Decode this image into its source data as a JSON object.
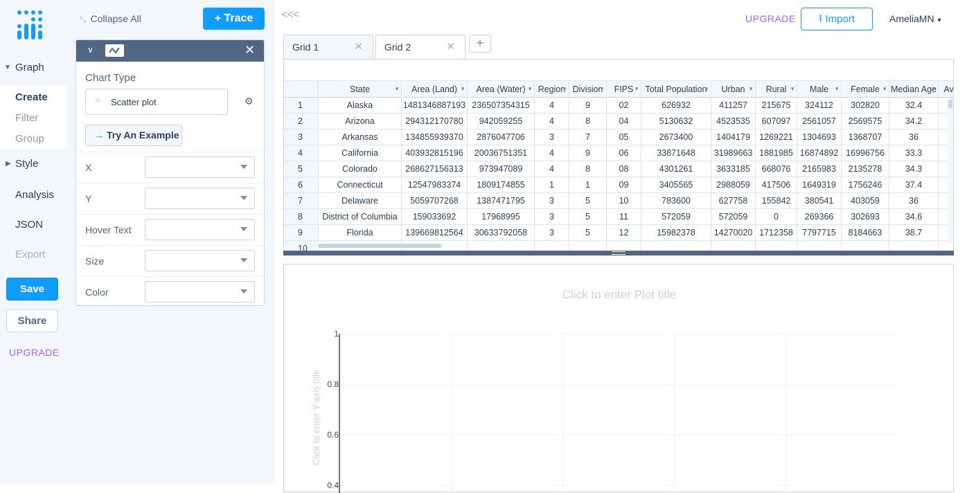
{
  "nav": {
    "graph": "Graph",
    "create": "Create",
    "filter": "Filter",
    "group": "Group",
    "style": "Style",
    "analysis": "Analysis",
    "json": "JSON",
    "export": "Export",
    "save": "Save",
    "share": "Share",
    "upgrade": "UPGRADE"
  },
  "panel": {
    "collapse_all": "Collapse All",
    "add_trace": "+ Trace",
    "chart_type_label": "Chart Type",
    "chart_type_value": "Scatter plot",
    "try_example": "Try An Example",
    "attributes": [
      "X",
      "Y",
      "Hover Text",
      "Size",
      "Color"
    ]
  },
  "topbar": {
    "back": "<<<",
    "upgrade": "UPGRADE",
    "import": "Import",
    "user": "AmeliaMN"
  },
  "tabs": [
    "Grid 1",
    "Grid 2"
  ],
  "grid": {
    "columns": [
      "State",
      "Area (Land)",
      "Area (Water)",
      "Region",
      "Division",
      "FIPS",
      "Total Population",
      "Urban",
      "Rural",
      "Male",
      "Female",
      "Median Age",
      "Av"
    ],
    "rows": [
      [
        "1",
        "Alaska",
        "1481346887193",
        "236507354315",
        "4",
        "9",
        "02",
        "626932",
        "411257",
        "215675",
        "324112",
        "302820",
        "32.4"
      ],
      [
        "2",
        "Arizona",
        "294312170780",
        "942059255",
        "4",
        "8",
        "04",
        "5130632",
        "4523535",
        "607097",
        "2561057",
        "2569575",
        "34.2"
      ],
      [
        "3",
        "Arkansas",
        "134855939370",
        "2876047706",
        "3",
        "7",
        "05",
        "2673400",
        "1404179",
        "1269221",
        "1304693",
        "1368707",
        "36"
      ],
      [
        "4",
        "California",
        "403932815196",
        "20036751351",
        "4",
        "9",
        "06",
        "33871648",
        "31989663",
        "1881985",
        "16874892",
        "16996756",
        "33.3"
      ],
      [
        "5",
        "Colorado",
        "268627156313",
        "973947089",
        "4",
        "8",
        "08",
        "4301261",
        "3633185",
        "668076",
        "2165983",
        "2135278",
        "34.3"
      ],
      [
        "6",
        "Connecticut",
        "12547983374",
        "1809174855",
        "1",
        "1",
        "09",
        "3405565",
        "2988059",
        "417506",
        "1649319",
        "1756246",
        "37.4"
      ],
      [
        "7",
        "Delaware",
        "5059707268",
        "1387471795",
        "3",
        "5",
        "10",
        "783600",
        "627758",
        "155842",
        "380541",
        "403059",
        "36"
      ],
      [
        "8",
        "District of Columbia",
        "159033692",
        "17968995",
        "3",
        "5",
        "11",
        "572059",
        "572059",
        "0",
        "269366",
        "302693",
        "34.6"
      ],
      [
        "9",
        "Florida",
        "139669812564",
        "30633792058",
        "3",
        "5",
        "12",
        "15982378",
        "14270020",
        "1712358",
        "7797715",
        "8184663",
        "38.7"
      ],
      [
        "10",
        "",
        "",
        "",
        "",
        "",
        "",
        "",
        "",
        "",
        "",
        "",
        ""
      ]
    ]
  },
  "plot": {
    "title_placeholder": "Click to enter Plot title",
    "ytitle_placeholder": "Click to enter Y axis title",
    "yticks": [
      "1",
      "0.8",
      "0.6",
      "0.4"
    ]
  },
  "colors": {
    "accent": "#119dff",
    "upgrade": "#ab63fa",
    "header": "#506784"
  }
}
